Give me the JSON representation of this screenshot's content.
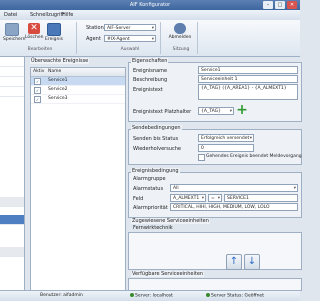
{
  "window": {
    "title": "AIF Konfigurator"
  },
  "menu": {
    "items": [
      "Datei",
      "Schnellzugriff",
      "Hilfe"
    ]
  },
  "ribbon": {
    "save": "Speichern",
    "delete": "Löschen",
    "events": "Ereignis",
    "edit_group": "Bearbeiten",
    "station_label": "Station",
    "station_value": "AIF-Server",
    "agent_label": "Agent",
    "agent_value": "#IX-Agent",
    "select_group": "Auswahl",
    "logout": "Abmelden",
    "session_group": "Sitzung"
  },
  "events": {
    "title": "Überwachte Ereignisse",
    "col_active": "Aktiv",
    "col_name": "Name",
    "rows": [
      "Service1",
      "Service2",
      "Service3"
    ]
  },
  "props": {
    "title": "Eigenschaften",
    "name_label": "Ereignisname",
    "name_value": "Service1",
    "desc_label": "Beschreibung",
    "desc_value": "Serviceeinheit 1",
    "text_label": "Ereignistext",
    "text_value": "{A_TAG} ({A_AREA1} - {A_ALMEXT1}",
    "placeholder_label": "Ereignistext Platzhalter",
    "placeholder_value": "{A_TAG}"
  },
  "send": {
    "title": "Sendebedingungen",
    "until_label": "Senden bis Status",
    "until_value": "Erfolgreich versendet",
    "retry_label": "Wiederholversuche",
    "retry_value": "0",
    "end_check": "Gehendes Ereignis beendet Meldevorgang"
  },
  "cond": {
    "title": "Ereignisbedingung",
    "group_label": "Alarmgruppe",
    "status_label": "Alarmstatus",
    "status_value": "All",
    "field_label": "Feld",
    "field_value": "A_ALMEXT1",
    "op_value": "=",
    "field_cond": "SERVICE1",
    "prio_label": "Alarmpriorität",
    "prio_value": "CRITICAL, HIHI, HIGH, MEDIUM, LOW, LOLO"
  },
  "assigned": {
    "title": "Zugewiesene Serviceeinheiten",
    "item": "Fernwirktechnik"
  },
  "available": {
    "title": "Verfügbare Serviceeinheiten"
  },
  "status": {
    "user": "Benutzer: aifadmin",
    "server": "Server: localhost",
    "server_status": "Server Status: Geöffnet"
  }
}
